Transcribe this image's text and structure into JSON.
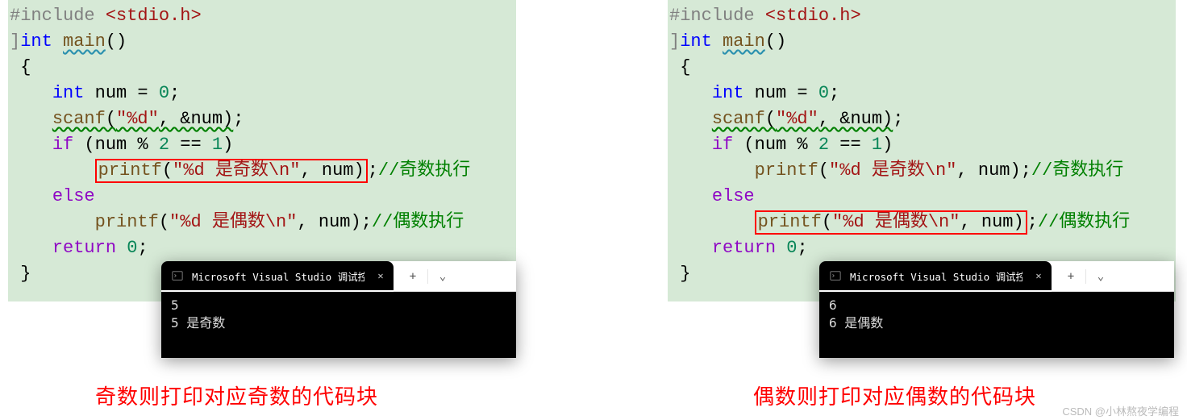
{
  "left": {
    "code": {
      "l1_pre": "#include ",
      "l1_lt": "<",
      "l1_hdr": "stdio.h",
      "l1_gt": ">",
      "l2_int": "int ",
      "l2_main": "main",
      "l2_paren": "()",
      "l3": "{",
      "l4_pre": "    ",
      "l4_int": "int",
      "l4_mid": " num = ",
      "l4_zero": "0",
      "l4_end": ";",
      "l5_pre": "    ",
      "l5_scanf": "scanf",
      "l5_open": "(",
      "l5_fmt": "\"%d\"",
      "l5_mid": ", &num)",
      "l5_end": ";",
      "l6_pre": "    ",
      "l6_if": "if",
      "l6_open": " (num % ",
      "l6_two": "2",
      "l6_eq": " == ",
      "l6_one": "1",
      "l6_close": ")",
      "l7_pre": "        ",
      "l7_printf": "printf",
      "l7_open": "(",
      "l7_str1": "\"%d 是奇数",
      "l7_esc": "\\n",
      "l7_str2": "\"",
      "l7_mid": ", num)",
      "l7_end": ";",
      "l7_comment": "//奇数执行",
      "l8_pre": "    ",
      "l8_else": "else",
      "l9_pre": "        ",
      "l9_printf": "printf",
      "l9_open": "(",
      "l9_str1": "\"%d 是偶数",
      "l9_esc": "\\n",
      "l9_str2": "\"",
      "l9_mid": ", num)",
      "l9_end": ";",
      "l9_comment": "//偶数执行",
      "l10_pre": "    ",
      "l10_return": "return",
      "l10_sp": " ",
      "l10_zero": "0",
      "l10_end": ";",
      "l11": "}"
    },
    "term": {
      "title": "Microsoft Visual Studio 调试控",
      "line1": "5",
      "line2": "5 是奇数"
    },
    "caption": "奇数则打印对应奇数的代码块"
  },
  "right": {
    "code": {
      "l1_pre": "#include ",
      "l1_lt": "<",
      "l1_hdr": "stdio.h",
      "l1_gt": ">",
      "l2_int": "int ",
      "l2_main": "main",
      "l2_paren": "()",
      "l3": "{",
      "l4_pre": "    ",
      "l4_int": "int",
      "l4_mid": " num = ",
      "l4_zero": "0",
      "l4_end": ";",
      "l5_pre": "    ",
      "l5_scanf": "scanf",
      "l5_open": "(",
      "l5_fmt": "\"%d\"",
      "l5_mid": ", &num)",
      "l5_end": ";",
      "l6_pre": "    ",
      "l6_if": "if",
      "l6_open": " (num % ",
      "l6_two": "2",
      "l6_eq": " == ",
      "l6_one": "1",
      "l6_close": ")",
      "l7_pre": "        ",
      "l7_printf": "printf",
      "l7_open": "(",
      "l7_str1": "\"%d 是奇数",
      "l7_esc": "\\n",
      "l7_str2": "\"",
      "l7_mid": ", num)",
      "l7_end": ";",
      "l7_comment": "//奇数执行",
      "l8_pre": "    ",
      "l8_else": "else",
      "l9_pre": "        ",
      "l9_printf": "printf",
      "l9_open": "(",
      "l9_str1": "\"%d 是偶数",
      "l9_esc": "\\n",
      "l9_str2": "\"",
      "l9_mid": ", num)",
      "l9_end": ";",
      "l9_comment": "//偶数执行",
      "l10_pre": "    ",
      "l10_return": "return",
      "l10_sp": " ",
      "l10_zero": "0",
      "l10_end": ";",
      "l11": "}"
    },
    "term": {
      "title": "Microsoft Visual Studio 调试控",
      "line1": "6",
      "line2": "6 是偶数"
    },
    "caption": "偶数则打印对应偶数的代码块"
  },
  "watermark": "CSDN @小林熬夜学编程",
  "icons": {
    "plus": "+",
    "chevron": "⌄",
    "close": "✕"
  }
}
